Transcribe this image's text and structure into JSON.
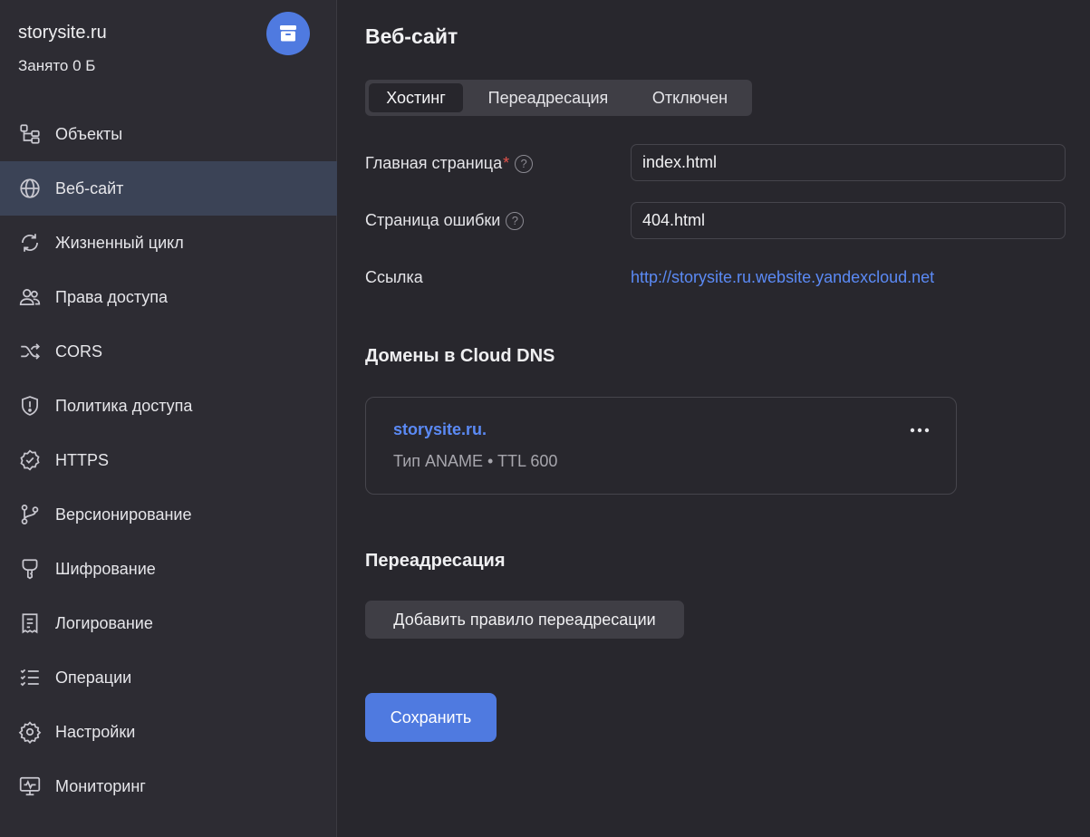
{
  "bucket": {
    "name": "storysite.ru",
    "usage": "Занято 0 Б"
  },
  "colors": {
    "accent": "#4f7ae0",
    "link": "#5b8af5",
    "active_nav": "#3b4356",
    "required": "#e5534b"
  },
  "nav": {
    "items": [
      {
        "label": "Объекты",
        "icon": "objects-tree-icon"
      },
      {
        "label": "Веб-сайт",
        "icon": "globe-icon",
        "active": true
      },
      {
        "label": "Жизненный цикл",
        "icon": "lifecycle-refresh-icon"
      },
      {
        "label": "Права доступа",
        "icon": "users-icon"
      },
      {
        "label": "CORS",
        "icon": "shuffle-icon"
      },
      {
        "label": "Политика доступа",
        "icon": "shield-icon"
      },
      {
        "label": "HTTPS",
        "icon": "certificate-check-icon"
      },
      {
        "label": "Версионирование",
        "icon": "branch-icon"
      },
      {
        "label": "Шифрование",
        "icon": "key-icon"
      },
      {
        "label": "Логирование",
        "icon": "receipt-icon"
      },
      {
        "label": "Операции",
        "icon": "checklist-icon"
      },
      {
        "label": "Настройки",
        "icon": "gear-icon"
      },
      {
        "label": "Мониторинг",
        "icon": "monitor-icon"
      }
    ]
  },
  "main": {
    "title": "Веб-сайт",
    "tabs": [
      {
        "label": "Хостинг",
        "active": true
      },
      {
        "label": "Переадресация"
      },
      {
        "label": "Отключен"
      }
    ],
    "form": {
      "index_label": "Главная страница",
      "index_required": "*",
      "index_value": "index.html",
      "error_label": "Страница ошибки",
      "error_value": "404.html",
      "help_glyph": "?",
      "link_label": "Ссылка",
      "link_value": "http://storysite.ru.website.yandexcloud.net"
    },
    "dns": {
      "title": "Домены в Cloud DNS",
      "records": [
        {
          "name": "storysite.ru.",
          "meta": "Тип ANAME • TTL 600"
        }
      ]
    },
    "redirect": {
      "title": "Переадресация",
      "add_button": "Добавить правило переадресации"
    },
    "save_button": "Сохранить"
  }
}
